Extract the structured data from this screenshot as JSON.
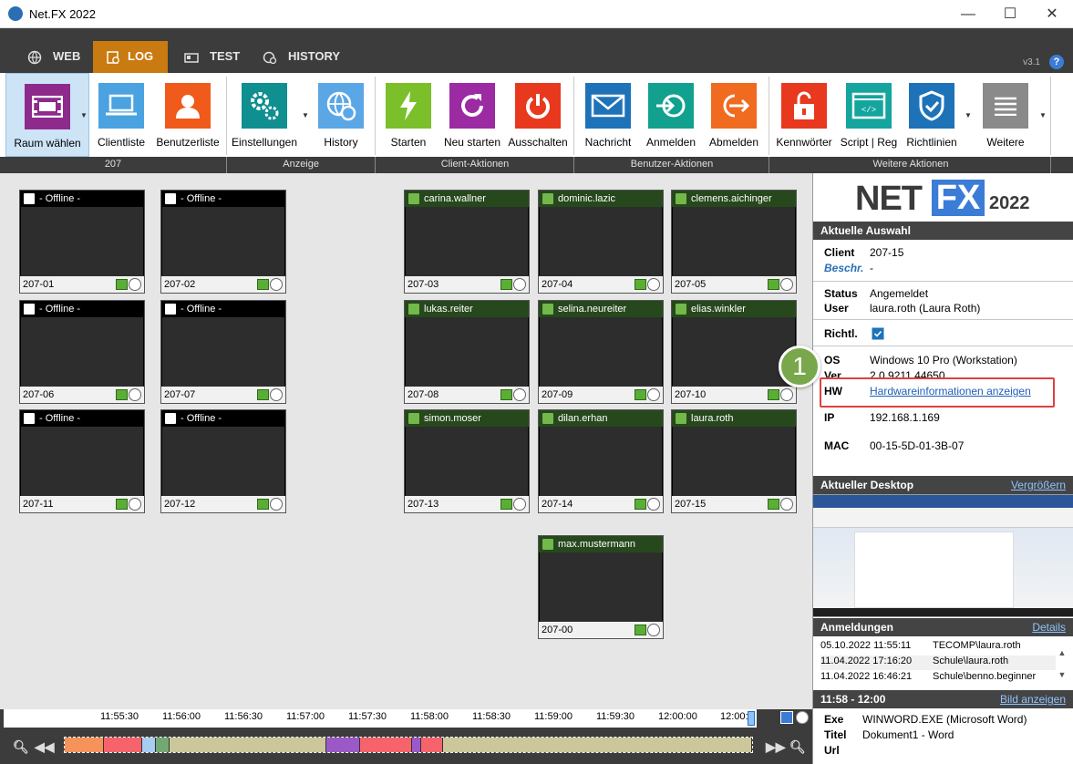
{
  "window": {
    "title": "Net.FX 2022",
    "minimize": "—",
    "maximize": "☐",
    "close": "✕"
  },
  "tabs": [
    {
      "label": "WEB",
      "icon": "globe-icon"
    },
    {
      "label": "LOG",
      "icon": "log-icon",
      "active": true
    },
    {
      "label": "TEST",
      "icon": "test-icon"
    },
    {
      "label": "HISTORY",
      "icon": "history-icon"
    }
  ],
  "version": "v3.1",
  "help": "?",
  "ribbon": {
    "buttons": [
      {
        "label": "Raum wählen",
        "icon": "room-icon",
        "color": "#8e2a8c"
      },
      {
        "label": "Clientliste",
        "icon": "laptop-icon",
        "color": "#4aa3e0"
      },
      {
        "label": "Benutzerliste",
        "icon": "user-icon",
        "color": "#f05a1a"
      },
      {
        "label": "Einstellungen",
        "icon": "gears-icon",
        "color": "#0f8f8f"
      },
      {
        "label": "History",
        "icon": "history-globe-icon",
        "color": "#5ba7e6"
      },
      {
        "label": "Starten",
        "icon": "power-bolt-icon",
        "color": "#7bbf2a"
      },
      {
        "label": "Neu starten",
        "icon": "restart-icon",
        "color": "#9c2aa2"
      },
      {
        "label": "Ausschalten",
        "icon": "power-icon",
        "color": "#e8381e"
      },
      {
        "label": "Nachricht",
        "icon": "mail-icon",
        "color": "#1e72b8"
      },
      {
        "label": "Anmelden",
        "icon": "login-icon",
        "color": "#12a08f"
      },
      {
        "label": "Abmelden",
        "icon": "logout-icon",
        "color": "#f06a1f"
      },
      {
        "label": "Kennwörter",
        "icon": "unlock-icon",
        "color": "#e8381e"
      },
      {
        "label": "Script | Reg",
        "icon": "script-icon",
        "color": "#14a59e"
      },
      {
        "label": "Richtlinien",
        "icon": "shield-check-icon",
        "color": "#1e72b8"
      },
      {
        "label": "Weitere",
        "icon": "menu-lines-icon",
        "color": "#8a8a8a"
      }
    ],
    "groups": [
      "207",
      "Anzeige",
      "Client-Aktionen",
      "Benutzer-Aktionen",
      "Weitere Aktionen"
    ]
  },
  "clients": [
    {
      "name": "207-01",
      "user": "- Offline -",
      "online": false,
      "screen": ""
    },
    {
      "name": "207-02",
      "user": "- Offline -",
      "online": false,
      "screen": ""
    },
    {
      "name": "207-06",
      "user": "- Offline -",
      "online": false,
      "screen": ""
    },
    {
      "name": "207-07",
      "user": "- Offline -",
      "online": false,
      "screen": ""
    },
    {
      "name": "207-11",
      "user": "- Offline -",
      "online": false,
      "screen": ""
    },
    {
      "name": "207-12",
      "user": "- Offline -",
      "online": false,
      "screen": ""
    },
    {
      "name": "207-03",
      "user": "carina.wallner",
      "online": true,
      "screen": "win"
    },
    {
      "name": "207-04",
      "user": "dominic.lazic",
      "online": true,
      "screen": "win"
    },
    {
      "name": "207-05",
      "user": "clemens.aichinger",
      "online": true,
      "screen": "win"
    },
    {
      "name": "207-08",
      "user": "lukas.reiter",
      "online": true,
      "screen": "win"
    },
    {
      "name": "207-09",
      "user": "selina.neureiter",
      "online": true,
      "screen": "white"
    },
    {
      "name": "207-10",
      "user": "elias.winkler",
      "online": true,
      "screen": "win"
    },
    {
      "name": "207-13",
      "user": "simon.moser",
      "online": true,
      "screen": "sky"
    },
    {
      "name": "207-14",
      "user": "dilan.erhan",
      "online": true,
      "screen": "white"
    },
    {
      "name": "207-15",
      "user": "laura.roth",
      "online": true,
      "screen": "pink"
    },
    {
      "name": "207-00",
      "user": "max.mustermann",
      "online": true,
      "screen": "blue"
    }
  ],
  "panel": {
    "logo": {
      "net": "NET",
      "fx": "FX",
      "year": "2022"
    },
    "selection_header": "Aktuelle Auswahl",
    "client_label": "Client",
    "client_value": "207-15",
    "beschr_label": "Beschr.",
    "beschr_value": "-",
    "status_label": "Status",
    "status_value": "Angemeldet",
    "user_label": "User",
    "user_value": "laura.roth (Laura Roth)",
    "richtl_label": "Richtl.",
    "os_label": "OS",
    "os_value": "Windows 10 Pro (Workstation)",
    "ver_label": "Ver",
    "ver_value": "2.0.9211.44650",
    "hw_label": "HW",
    "hw_link": "Hardwareinformationen anzeigen",
    "ip_label": "IP",
    "ip_value": "192.168.1.169",
    "mac_label": "MAC",
    "mac_value": "00-15-5D-01-3B-07",
    "desktop_header": "Aktueller Desktop",
    "desktop_link": "Vergrößern",
    "logins_header": "Anmeldungen",
    "logins_link": "Details",
    "logins": [
      {
        "time": "05.10.2022 11:55:11",
        "user": "TECOMP\\laura.roth"
      },
      {
        "time": "11.04.2022 17:16:20",
        "user": "Schule\\laura.roth"
      },
      {
        "time": "11.04.2022 16:46:21",
        "user": "Schule\\benno.beginner"
      }
    ],
    "range_header": "11:58 - 12:00",
    "range_link": "Bild anzeigen",
    "exe_label": "Exe",
    "exe_value": "WINWORD.EXE (Microsoft Word)",
    "titel_label": "Titel",
    "titel_value": "Dokument1 - Word",
    "url_label": "Url",
    "url_value": ""
  },
  "callout": "1",
  "timeline": {
    "ticks": [
      "11:55:30",
      "11:56:00",
      "11:56:30",
      "11:57:00",
      "11:57:30",
      "11:58:00",
      "11:58:30",
      "11:59:00",
      "11:59:30",
      "12:00:00",
      "12:00:"
    ],
    "segments": [
      {
        "color": "#f6935b",
        "from": 0,
        "to": 0.057
      },
      {
        "color": "#f7636b",
        "from": 0.057,
        "to": 0.113
      },
      {
        "color": "#a7cdf0",
        "from": 0.113,
        "to": 0.133
      },
      {
        "color": "#74a873",
        "from": 0.133,
        "to": 0.152
      },
      {
        "color": "#cbc79b",
        "from": 0.152,
        "to": 0.38
      },
      {
        "color": "#9b59c8",
        "from": 0.38,
        "to": 0.43
      },
      {
        "color": "#f7636b",
        "from": 0.43,
        "to": 0.505
      },
      {
        "color": "#9b59c8",
        "from": 0.505,
        "to": 0.518
      },
      {
        "color": "#f7636b",
        "from": 0.518,
        "to": 0.551
      },
      {
        "color": "#cbc79b",
        "from": 0.551,
        "to": 1
      }
    ]
  }
}
